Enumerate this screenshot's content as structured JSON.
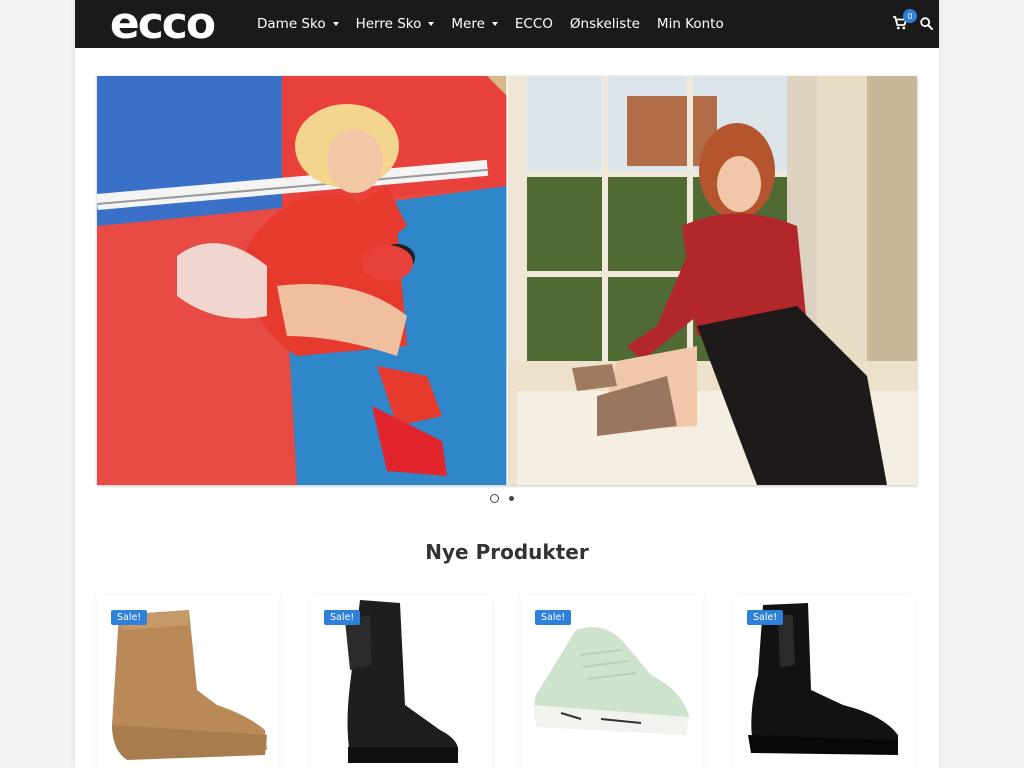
{
  "header": {
    "brand": "ecco",
    "nav": [
      {
        "label": "Dame Sko",
        "has_dropdown": true
      },
      {
        "label": "Herre Sko",
        "has_dropdown": true
      },
      {
        "label": "Mere",
        "has_dropdown": true
      },
      {
        "label": "ECCO",
        "has_dropdown": false
      },
      {
        "label": "Ønskeliste",
        "has_dropdown": false
      },
      {
        "label": "Min Konto",
        "has_dropdown": false
      }
    ],
    "cart_count": "0",
    "cart_icon": "shopping-cart-icon",
    "search_icon": "search-icon"
  },
  "hero": {
    "slides": 2,
    "active_slide": 1
  },
  "products_section": {
    "title": "Nye Produkter",
    "products": [
      {
        "badge": "Sale!",
        "image": "tan suede ankle boot"
      },
      {
        "badge": "Sale!",
        "image": "black leather mid-calf boot"
      },
      {
        "badge": "Sale!",
        "image": "mint green lace-up sneaker"
      },
      {
        "badge": "Sale!",
        "image": "black chelsea boot"
      }
    ]
  },
  "colors": {
    "header_bg": "#1a1a1a",
    "accent": "#2f80d8",
    "text": "#333333"
  }
}
